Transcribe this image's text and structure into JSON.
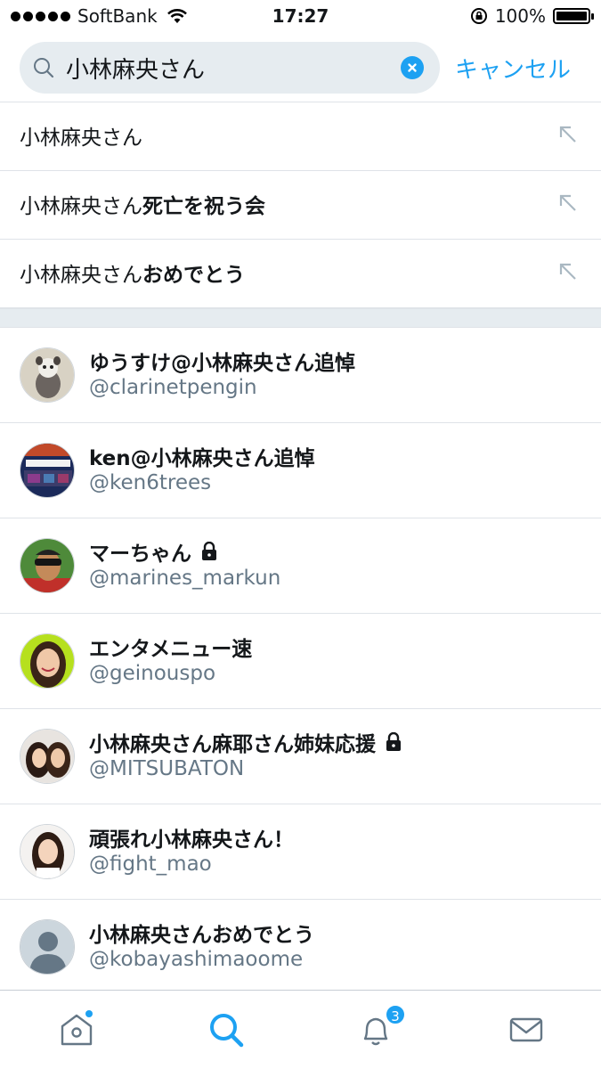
{
  "status_bar": {
    "carrier": "SoftBank",
    "time": "17:27",
    "battery": "100%"
  },
  "search": {
    "query": "小林麻央さん",
    "cancel_label": "キャンセル"
  },
  "suggestions": [
    {
      "prefix": "小林麻央さん",
      "bold": ""
    },
    {
      "prefix": "小林麻央さん",
      "bold": "死亡を祝う会"
    },
    {
      "prefix": "小林麻央さん",
      "bold": "おめでとう"
    }
  ],
  "users": [
    {
      "name": "ゆうすけ@小林麻央さん追悼",
      "handle": "@clarinetpengin",
      "protected": false
    },
    {
      "name": "ken@小林麻央さん追悼",
      "handle": "@ken6trees",
      "protected": false
    },
    {
      "name": "マーちゃん",
      "handle": "@marines_markun",
      "protected": true
    },
    {
      "name": "エンタメニュー速",
      "handle": "@geinouspo",
      "protected": false
    },
    {
      "name": "小林麻央さん麻耶さん姉妹応援",
      "handle": "@MITSUBATON",
      "protected": true
    },
    {
      "name": "頑張れ小林麻央さん！",
      "handle": "@fight_mao",
      "protected": false
    },
    {
      "name": "小林麻央さんおめでとう",
      "handle": "@kobayashimaoome",
      "protected": false
    }
  ],
  "tab_bar": {
    "notification_count": "3",
    "icons": [
      "home-icon",
      "search-icon",
      "notifications-icon",
      "messages-icon"
    ]
  },
  "colors": {
    "accent": "#1da1f2",
    "secondary_text": "#657786",
    "search_bg": "#e6ecf0"
  }
}
